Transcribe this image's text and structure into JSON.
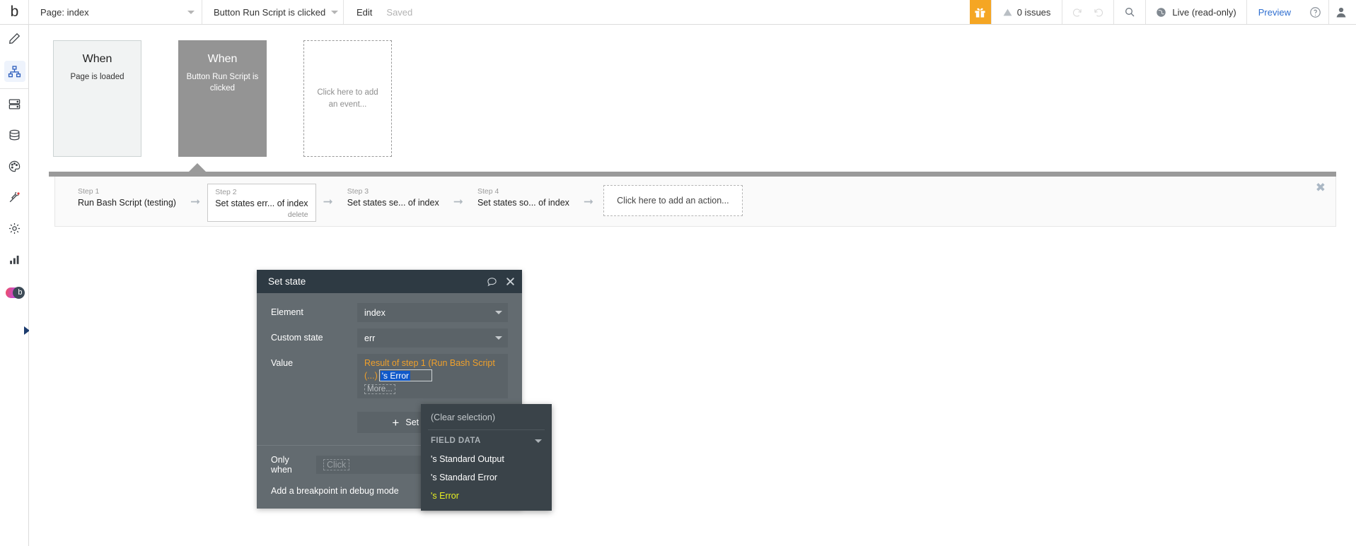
{
  "topbar": {
    "logo": "b",
    "page_select": {
      "label": "Page: index",
      "icon": "chevron-down-icon"
    },
    "event_select": {
      "label": "Button Run Script is clicked",
      "icon": "chevron-down-icon"
    },
    "edit_label": "Edit",
    "saved_label": "Saved",
    "gift_icon": "gift-icon",
    "issues_label": "0 issues",
    "issues_icon": "warning-triangle-icon",
    "undo_icon": "undo-icon",
    "redo_icon": "redo-icon",
    "search_icon": "search-icon",
    "live_label": "Live (read-only)",
    "live_icon": "globe-icon",
    "preview_label": "Preview",
    "help_icon": "question-circle-icon",
    "avatar_icon": "user-avatar-icon",
    "accent_gift_bg": "#f5a623",
    "preview_color": "#2f6fd0"
  },
  "rail": {
    "items": [
      {
        "name": "design-pencil",
        "icon": "pencil-icon",
        "active": false
      },
      {
        "name": "workflow",
        "icon": "workflow-tree-icon",
        "active": true
      },
      {
        "name": "data-layout",
        "icon": "server-rows-icon",
        "active": false
      },
      {
        "name": "database",
        "icon": "database-cylinder-icon",
        "active": false
      },
      {
        "name": "styles",
        "icon": "palette-icon",
        "active": false
      },
      {
        "name": "plugins",
        "icon": "plug-icon",
        "active": false
      },
      {
        "name": "settings",
        "icon": "gear-icon",
        "active": false
      },
      {
        "name": "logs",
        "icon": "bar-chart-icon",
        "active": false
      }
    ],
    "logo_icon": "bubble-logo-icon",
    "expand_icon": "expand-triangle-icon"
  },
  "events": [
    {
      "when": "When",
      "desc": "Page is loaded",
      "state": "plain"
    },
    {
      "when": "When",
      "desc": "Button Run Script is clicked",
      "state": "selected"
    },
    {
      "placeholder": "Click here to add an event...",
      "state": "dashed"
    }
  ],
  "workflow": {
    "close_icon": "close-icon",
    "arrow_icon": "arrow-right-icon",
    "steps": [
      {
        "num": "Step 1",
        "title": "Run Bash Script (testing)",
        "boxed": false,
        "delete": ""
      },
      {
        "num": "Step 2",
        "title": "Set states err... of index",
        "boxed": true,
        "delete": "delete"
      },
      {
        "num": "Step 3",
        "title": "Set states se... of index",
        "boxed": false,
        "delete": ""
      },
      {
        "num": "Step 4",
        "title": "Set states so... of index",
        "boxed": false,
        "delete": ""
      }
    ],
    "add_action": "Click here to add an action..."
  },
  "dialog": {
    "title": "Set state",
    "comment_icon": "speech-bubble-icon",
    "close_icon": "close-icon",
    "element_label": "Element",
    "element_value": "index",
    "custom_state_label": "Custom state",
    "custom_state_value": "err",
    "value_label": "Value",
    "value_expression": "Result of step 1 (Run Bash Script (...)",
    "value_input_text": "'s Error",
    "more_label": "More...",
    "set_another_label": "Set another state",
    "set_another_icon": "plus-icon",
    "only_when_label": "Only when",
    "only_when_placeholder": "Click",
    "breakpoint_label": "Add a breakpoint in debug mode",
    "breakpoint_checked": false,
    "expression_color": "#f0a02a",
    "selection_color": "#1059c9"
  },
  "dropdown": {
    "clear_label": "(Clear selection)",
    "group_label": "FIELD DATA",
    "group_caret_icon": "chevron-down-icon",
    "options": [
      {
        "label": "'s Standard Output",
        "highlighted": false
      },
      {
        "label": "'s Standard Error",
        "highlighted": false
      },
      {
        "label": "'s Error",
        "highlighted": true
      }
    ],
    "highlight_color": "#e8f021"
  }
}
